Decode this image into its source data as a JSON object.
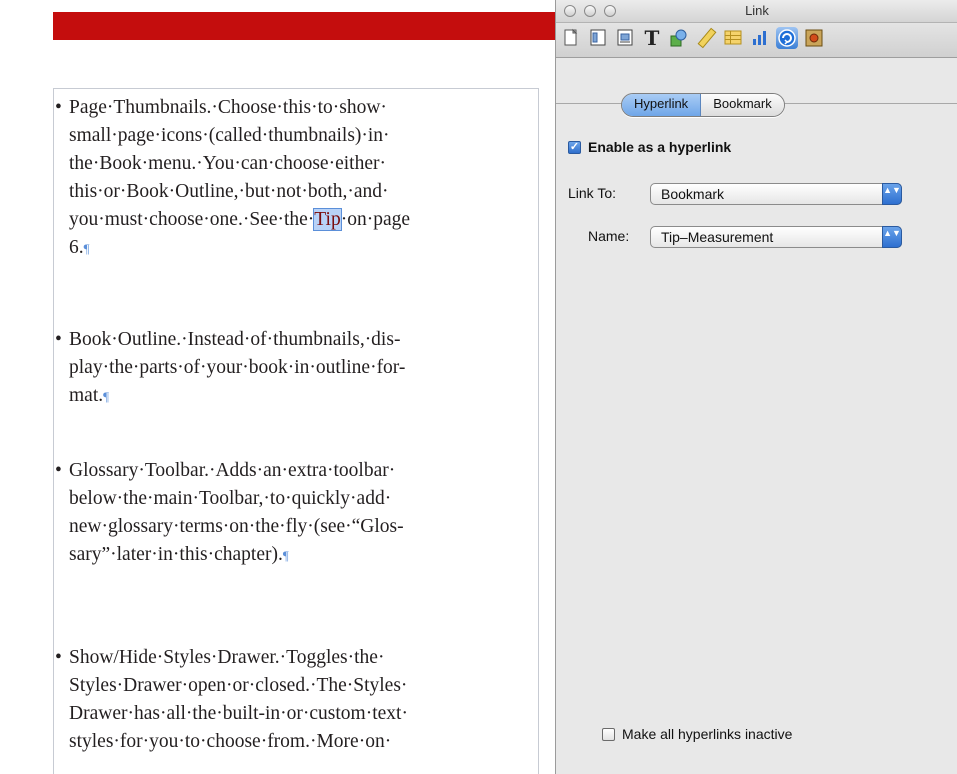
{
  "document": {
    "paragraphs": [
      {
        "bullet": "•",
        "lines": [
          "Page·Thumbnails.·Choose·this·to·show·",
          "small·page·icons·(called·thumbnails)·in·",
          "the·Book·menu.·You·can·choose·either·",
          "this·or·Book·Outline,·but·not·both,·and·"
        ],
        "tip_line_prefix": "you·must·choose·one.·See·the·",
        "tip_word": "Tip",
        "tip_line_suffix": "·on·page",
        "last_line": "6.",
        "pilcrow": "¶"
      },
      {
        "bullet": "•",
        "lines": [
          "Book·Outline.·Instead·of·thumbnails,·dis-",
          "play·the·parts·of·your·book·in·outline·for-",
          "mat."
        ],
        "pilcrow": "¶"
      },
      {
        "bullet": "•",
        "lines": [
          "Glossary·Toolbar.·Adds·an·extra·toolbar·",
          "below·the·main·Toolbar,·to·quickly·add·",
          "new·glossary·terms·on·the·fly·(see·“Glos-",
          "sary”·later·in·this·chapter)."
        ],
        "pilcrow": "¶"
      },
      {
        "bullet": "•",
        "lines": [
          "Show/Hide·Styles·Drawer.·Toggles·the·",
          "Styles·Drawer·open·or·closed.·The·Styles·",
          "Drawer·has·all·the·built-in·or·custom·text·",
          "styles·for·you·to·choose·from.·More·on·"
        ]
      }
    ]
  },
  "inspector": {
    "window_title": "Link",
    "toolbar_icons": [
      "document-icon",
      "layout-icon",
      "wrap-icon",
      "text-icon",
      "graphic-icon",
      "metrics-icon",
      "table-icon",
      "chart-icon",
      "link-icon",
      "quicktime-icon"
    ],
    "selected_toolbar_icon": "link-icon",
    "tabs": [
      "Hyperlink",
      "Bookmark"
    ],
    "active_tab": "Hyperlink",
    "enable_hyperlink": {
      "label": "Enable as a hyperlink",
      "checked": true
    },
    "link_to": {
      "label": "Link To:",
      "value": "Bookmark"
    },
    "name": {
      "label": "Name:",
      "value": "Tip–Measurement"
    },
    "make_inactive": {
      "label": "Make all hyperlinks inactive",
      "checked": false
    },
    "check_glyph": "✓",
    "select_arrows": "▲▼"
  }
}
